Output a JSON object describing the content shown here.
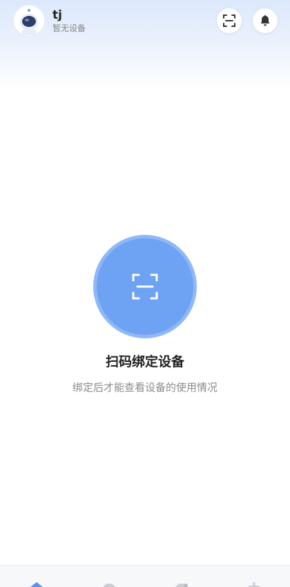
{
  "header": {
    "user_name": "tj",
    "user_status": "暂无设备",
    "avatar_icon": "astronaut-avatar-icon",
    "scan_icon": "scan-icon",
    "bell_icon": "bell-icon"
  },
  "empty_state": {
    "icon": "scan-icon",
    "title": "扫码绑定设备",
    "description": "绑定后才能查看设备的使用情况"
  },
  "bottom_nav": {
    "items": [
      {
        "icon": "home-icon",
        "active": true
      },
      {
        "icon": "nav-icon-2",
        "active": false
      },
      {
        "icon": "nav-icon-3",
        "active": false
      },
      {
        "icon": "nav-icon-4",
        "active": false
      }
    ]
  },
  "colors": {
    "accent": "#6ea2f3",
    "active_nav": "#5b93ee",
    "inactive_nav": "#c9cdd3"
  }
}
